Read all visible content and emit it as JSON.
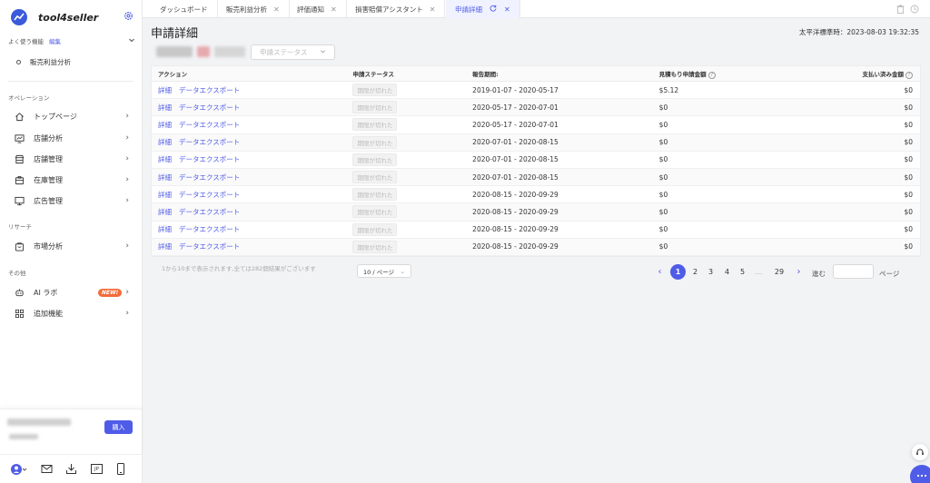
{
  "brand": {
    "name": "tool4seller"
  },
  "sidebar": {
    "favorites_title": "よく使う機能",
    "favorites_edit": "編集",
    "favorites": [
      {
        "label": "販売利益分析"
      }
    ],
    "section_operation": "オペレーション",
    "operation_items": [
      {
        "label": "トップページ",
        "icon": "home-icon"
      },
      {
        "label": "店舗分析",
        "icon": "monitor-chart-icon"
      },
      {
        "label": "店舗管理",
        "icon": "store-icon"
      },
      {
        "label": "在庫管理",
        "icon": "inventory-box-icon"
      },
      {
        "label": "広告管理",
        "icon": "display-icon"
      }
    ],
    "section_research": "リサーチ",
    "research_items": [
      {
        "label": "市場分析",
        "icon": "bag-icon"
      }
    ],
    "section_other": "その他",
    "other_items": [
      {
        "label": "AI ラボ",
        "icon": "robot-icon",
        "badge": "NEW!"
      },
      {
        "label": "追加機能",
        "icon": "grid-icon"
      }
    ],
    "buy_label": "購入",
    "bottom_icons": [
      "avatar-icon",
      "mail-icon",
      "download-icon",
      "jp-language-icon",
      "mobile-icon"
    ],
    "jp_label": "JP"
  },
  "tabs": [
    {
      "label": "ダッシュボード",
      "closable": false
    },
    {
      "label": "販売利益分析",
      "closable": true
    },
    {
      "label": "評価通知",
      "closable": true
    },
    {
      "label": "損害賠償アシスタント",
      "closable": true
    },
    {
      "label": "申請詳細",
      "closable": true,
      "active": true
    }
  ],
  "page": {
    "title": "申請詳細",
    "timezone": "太平洋標準時：2023-08-03 19:32:35",
    "status_placeholder": "申請ステータス"
  },
  "table": {
    "headers": {
      "action": "アクション",
      "status": "申請ステータス",
      "period": "報告期間:",
      "estimate": "見積もり申請金額",
      "paid": "支払い済み金額"
    },
    "action_detail": "詳細",
    "action_export": "データエクスポート",
    "rows": [
      {
        "status": "期限が切れた",
        "period": "2019-01-07 - 2020-05-17",
        "estimate": "$5.12",
        "paid": "$0"
      },
      {
        "status": "期限が切れた",
        "period": "2020-05-17 - 2020-07-01",
        "estimate": "$0",
        "paid": "$0"
      },
      {
        "status": "期限が切れた",
        "period": "2020-05-17 - 2020-07-01",
        "estimate": "$0",
        "paid": "$0"
      },
      {
        "status": "期限が切れた",
        "period": "2020-07-01 - 2020-08-15",
        "estimate": "$0",
        "paid": "$0"
      },
      {
        "status": "期限が切れた",
        "period": "2020-07-01 - 2020-08-15",
        "estimate": "$0",
        "paid": "$0"
      },
      {
        "status": "期限が切れた",
        "period": "2020-07-01 - 2020-08-15",
        "estimate": "$0",
        "paid": "$0"
      },
      {
        "status": "期限が切れた",
        "period": "2020-08-15 - 2020-09-29",
        "estimate": "$0",
        "paid": "$0"
      },
      {
        "status": "期限が切れた",
        "period": "2020-08-15 - 2020-09-29",
        "estimate": "$0",
        "paid": "$0"
      },
      {
        "status": "期限が切れた",
        "period": "2020-08-15 - 2020-09-29",
        "estimate": "$0",
        "paid": "$0"
      },
      {
        "status": "期限が切れた",
        "period": "2020-08-15 - 2020-09-29",
        "estimate": "$0",
        "paid": "$0"
      }
    ]
  },
  "pagination": {
    "summary": "1から10まで表示されます,全ては282個結果がございます",
    "page_size": "10 / ページ",
    "pages": [
      "1",
      "2",
      "3",
      "4",
      "5",
      "...",
      "29"
    ],
    "current": "1",
    "goto_label": "進む",
    "goto_suffix": "ページ"
  },
  "colors": {
    "accent": "#4f5ce8",
    "badge": "#f26b3a"
  }
}
